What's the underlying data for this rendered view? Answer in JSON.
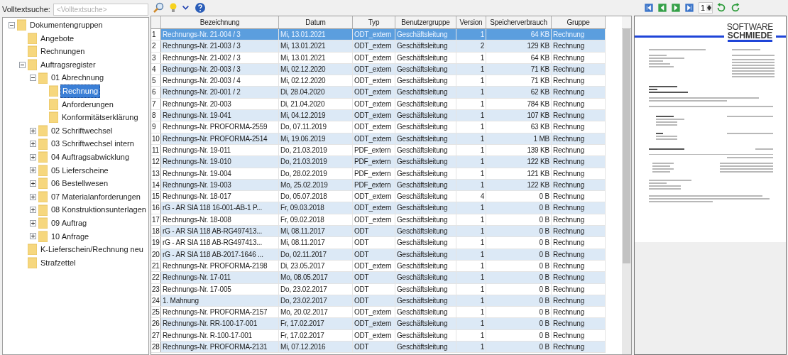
{
  "search": {
    "label": "Volltextsuche:",
    "placeholder": "<Volltextsuche>"
  },
  "tree": [
    {
      "label": "Dokumentengruppen",
      "expanded": true,
      "selected": false,
      "children": [
        {
          "label": "Angebote",
          "selected": false
        },
        {
          "label": "Rechnungen",
          "selected": false
        },
        {
          "label": "Auftragsregister",
          "expanded": true,
          "selected": false,
          "children": [
            {
              "label": "01 Abrechnung",
              "expanded": true,
              "selected": false,
              "children": [
                {
                  "label": "Rechnung",
                  "selected": true
                },
                {
                  "label": "Anforderungen",
                  "selected": false
                },
                {
                  "label": "Konformitätserklärung",
                  "selected": false
                }
              ]
            },
            {
              "label": "02 Schriftwechsel",
              "expanded": false,
              "selected": false
            },
            {
              "label": "03 Schriftwechsel intern",
              "expanded": false,
              "selected": false
            },
            {
              "label": "04 Auftragsabwicklung",
              "expanded": false,
              "selected": false
            },
            {
              "label": "05 Lieferscheine",
              "expanded": false,
              "selected": false
            },
            {
              "label": "06 Bestellwesen",
              "expanded": false,
              "selected": false
            },
            {
              "label": "07 Materialanforderungen",
              "expanded": false,
              "selected": false
            },
            {
              "label": "08 Konstruktionsunterlagen",
              "expanded": false,
              "selected": false
            },
            {
              "label": "09 Auftrag",
              "expanded": false,
              "selected": false
            },
            {
              "label": "10 Anfrage",
              "expanded": false,
              "selected": false
            }
          ]
        },
        {
          "label": "K-Lieferschein/Rechnung neu",
          "selected": false
        },
        {
          "label": "Strafzettel",
          "selected": false
        }
      ]
    }
  ],
  "table": {
    "columns": [
      "Bezeichnung",
      "Datum",
      "Typ",
      "Benutzergruppe",
      "Version",
      "Speicherverbrauch",
      "Gruppe"
    ],
    "rows": [
      {
        "n": "1",
        "cells": [
          "Rechnungs-Nr. 21-004 / 3",
          "Mi, 13.01.2021",
          "ODT_extern",
          "Geschäftsleitung",
          "1",
          "64 KB",
          "Rechnung"
        ],
        "selected": true
      },
      {
        "n": "2",
        "cells": [
          "Rechnungs-Nr. 21-003 / 3",
          "Mi, 13.01.2021",
          "ODT_extern",
          "Geschäftsleitung",
          "2",
          "129 KB",
          "Rechnung"
        ],
        "selected": false
      },
      {
        "n": "3",
        "cells": [
          "Rechnungs-Nr. 21-002 / 3",
          "Mi, 13.01.2021",
          "ODT_extern",
          "Geschäftsleitung",
          "1",
          "64 KB",
          "Rechnung"
        ],
        "selected": false
      },
      {
        "n": "4",
        "cells": [
          "Rechnungs-Nr. 20-003 / 3",
          "Mi, 02.12.2020",
          "ODT_extern",
          "Geschäftsleitung",
          "1",
          "71 KB",
          "Rechnung"
        ],
        "selected": false
      },
      {
        "n": "5",
        "cells": [
          "Rechnungs-Nr. 20-003 / 4",
          "Mi, 02.12.2020",
          "ODT_extern",
          "Geschäftsleitung",
          "1",
          "71 KB",
          "Rechnung"
        ],
        "selected": false
      },
      {
        "n": "6",
        "cells": [
          "Rechnungs-Nr. 20-001 / 2",
          "Di, 28.04.2020",
          "ODT_extern",
          "Geschäftsleitung",
          "1",
          "62 KB",
          "Rechnung"
        ],
        "selected": false
      },
      {
        "n": "7",
        "cells": [
          "Rechnungs-Nr. 20-003",
          "Di, 21.04.2020",
          "ODT_extern",
          "Geschäftsleitung",
          "1",
          "784 KB",
          "Rechnung"
        ],
        "selected": false
      },
      {
        "n": "8",
        "cells": [
          "Rechnungs-Nr. 19-041",
          "Mi, 04.12.2019",
          "ODT_extern",
          "Geschäftsleitung",
          "1",
          "107 KB",
          "Rechnung"
        ],
        "selected": false
      },
      {
        "n": "9",
        "cells": [
          "Rechnungs-Nr. PROFORMA-2559",
          "Do, 07.11.2019",
          "ODT_extern",
          "Geschäftsleitung",
          "1",
          "63 KB",
          "Rechnung"
        ],
        "selected": false
      },
      {
        "n": "10",
        "cells": [
          "Rechnungs-Nr. PROFORMA-2514",
          "Mi, 19.06.2019",
          "ODT_extern",
          "Geschäftsleitung",
          "1",
          "1 MB",
          "Rechnung"
        ],
        "selected": false
      },
      {
        "n": "11",
        "cells": [
          "Rechnungs-Nr. 19-011",
          "Do, 21.03.2019",
          "PDF_extern",
          "Geschäftsleitung",
          "1",
          "139 KB",
          "Rechnung"
        ],
        "selected": false
      },
      {
        "n": "12",
        "cells": [
          "Rechnungs-Nr. 19-010",
          "Do, 21.03.2019",
          "PDF_extern",
          "Geschäftsleitung",
          "1",
          "122 KB",
          "Rechnung"
        ],
        "selected": false
      },
      {
        "n": "13",
        "cells": [
          "Rechnungs-Nr. 19-004",
          "Do, 28.02.2019",
          "PDF_extern",
          "Geschäftsleitung",
          "1",
          "121 KB",
          "Rechnung"
        ],
        "selected": false
      },
      {
        "n": "14",
        "cells": [
          "Rechnungs-Nr. 19-003",
          "Mo, 25.02.2019",
          "PDF_extern",
          "Geschäftsleitung",
          "1",
          "122 KB",
          "Rechnung"
        ],
        "selected": false
      },
      {
        "n": "15",
        "cells": [
          "Rechnungs-Nr. 18-017",
          "Do, 05.07.2018",
          "ODT_extern",
          "Geschäftsleitung",
          "4",
          "0 B",
          "Rechnung"
        ],
        "selected": false
      },
      {
        "n": "16",
        "cells": [
          "rG - AR SIA 118 16-001-AB-1 P...",
          "Fr, 09.03.2018",
          "ODT_extern",
          "Geschäftsleitung",
          "1",
          "0 B",
          "Rechnung"
        ],
        "selected": false
      },
      {
        "n": "17",
        "cells": [
          "Rechnungs-Nr. 18-008",
          "Fr, 09.02.2018",
          "ODT_extern",
          "Geschäftsleitung",
          "1",
          "0 B",
          "Rechnung"
        ],
        "selected": false
      },
      {
        "n": "18",
        "cells": [
          "rG - AR SIA 118 AB-RG497413...",
          "Mi, 08.11.2017",
          "ODT",
          "Geschäftsleitung",
          "1",
          "0 B",
          "Rechnung"
        ],
        "selected": false
      },
      {
        "n": "19",
        "cells": [
          "rG - AR SIA 118 AB-RG497413...",
          "Mi, 08.11.2017",
          "ODT",
          "Geschäftsleitung",
          "1",
          "0 B",
          "Rechnung"
        ],
        "selected": false
      },
      {
        "n": "20",
        "cells": [
          "rG - AR SIA 118 AB-2017-1646 ...",
          "Do, 02.11.2017",
          "ODT",
          "Geschäftsleitung",
          "1",
          "0 B",
          "Rechnung"
        ],
        "selected": false
      },
      {
        "n": "21",
        "cells": [
          "Rechnungs-Nr. PROFORMA-2198",
          "Di, 23.05.2017",
          "ODT_extern",
          "Geschäftsleitung",
          "1",
          "0 B",
          "Rechnung"
        ],
        "selected": false
      },
      {
        "n": "22",
        "cells": [
          "Rechnungs-Nr. 17-011",
          "Mo, 08.05.2017",
          "ODT",
          "Geschäftsleitung",
          "1",
          "0 B",
          "Rechnung"
        ],
        "selected": false
      },
      {
        "n": "23",
        "cells": [
          "Rechnungs-Nr. 17-005",
          "Do, 23.02.2017",
          "ODT",
          "Geschäftsleitung",
          "1",
          "0 B",
          "Rechnung"
        ],
        "selected": false
      },
      {
        "n": "24",
        "cells": [
          "1. Mahnung",
          "Do, 23.02.2017",
          "ODT",
          "Geschäftsleitung",
          "1",
          "0 B",
          "Rechnung"
        ],
        "selected": false
      },
      {
        "n": "25",
        "cells": [
          "Rechnungs-Nr. PROFORMA-2157",
          "Mo, 20.02.2017",
          "ODT_extern",
          "Geschäftsleitung",
          "1",
          "0 B",
          "Rechnung"
        ],
        "selected": false
      },
      {
        "n": "26",
        "cells": [
          "Rechnungs-Nr. RR-100-17-001",
          "Fr, 17.02.2017",
          "ODT_extern",
          "Geschäftsleitung",
          "1",
          "0 B",
          "Rechnung"
        ],
        "selected": false
      },
      {
        "n": "27",
        "cells": [
          "Rechnungs-Nr. R-100-17-001",
          "Fr, 17.02.2017",
          "ODT_extern",
          "Geschäftsleitung",
          "1",
          "0 B",
          "Rechnung"
        ],
        "selected": false
      },
      {
        "n": "28",
        "cells": [
          "Rechnungs-Nr. PROFORMA-2131",
          "Mi, 07.12.2016",
          "ODT",
          "Geschäftsleitung",
          "1",
          "0 B",
          "Rechnung"
        ],
        "selected": false
      }
    ]
  },
  "preview": {
    "page": "1",
    "logo_top": "SOFTWARE",
    "logo_bottom": "SCHMIEDE"
  }
}
